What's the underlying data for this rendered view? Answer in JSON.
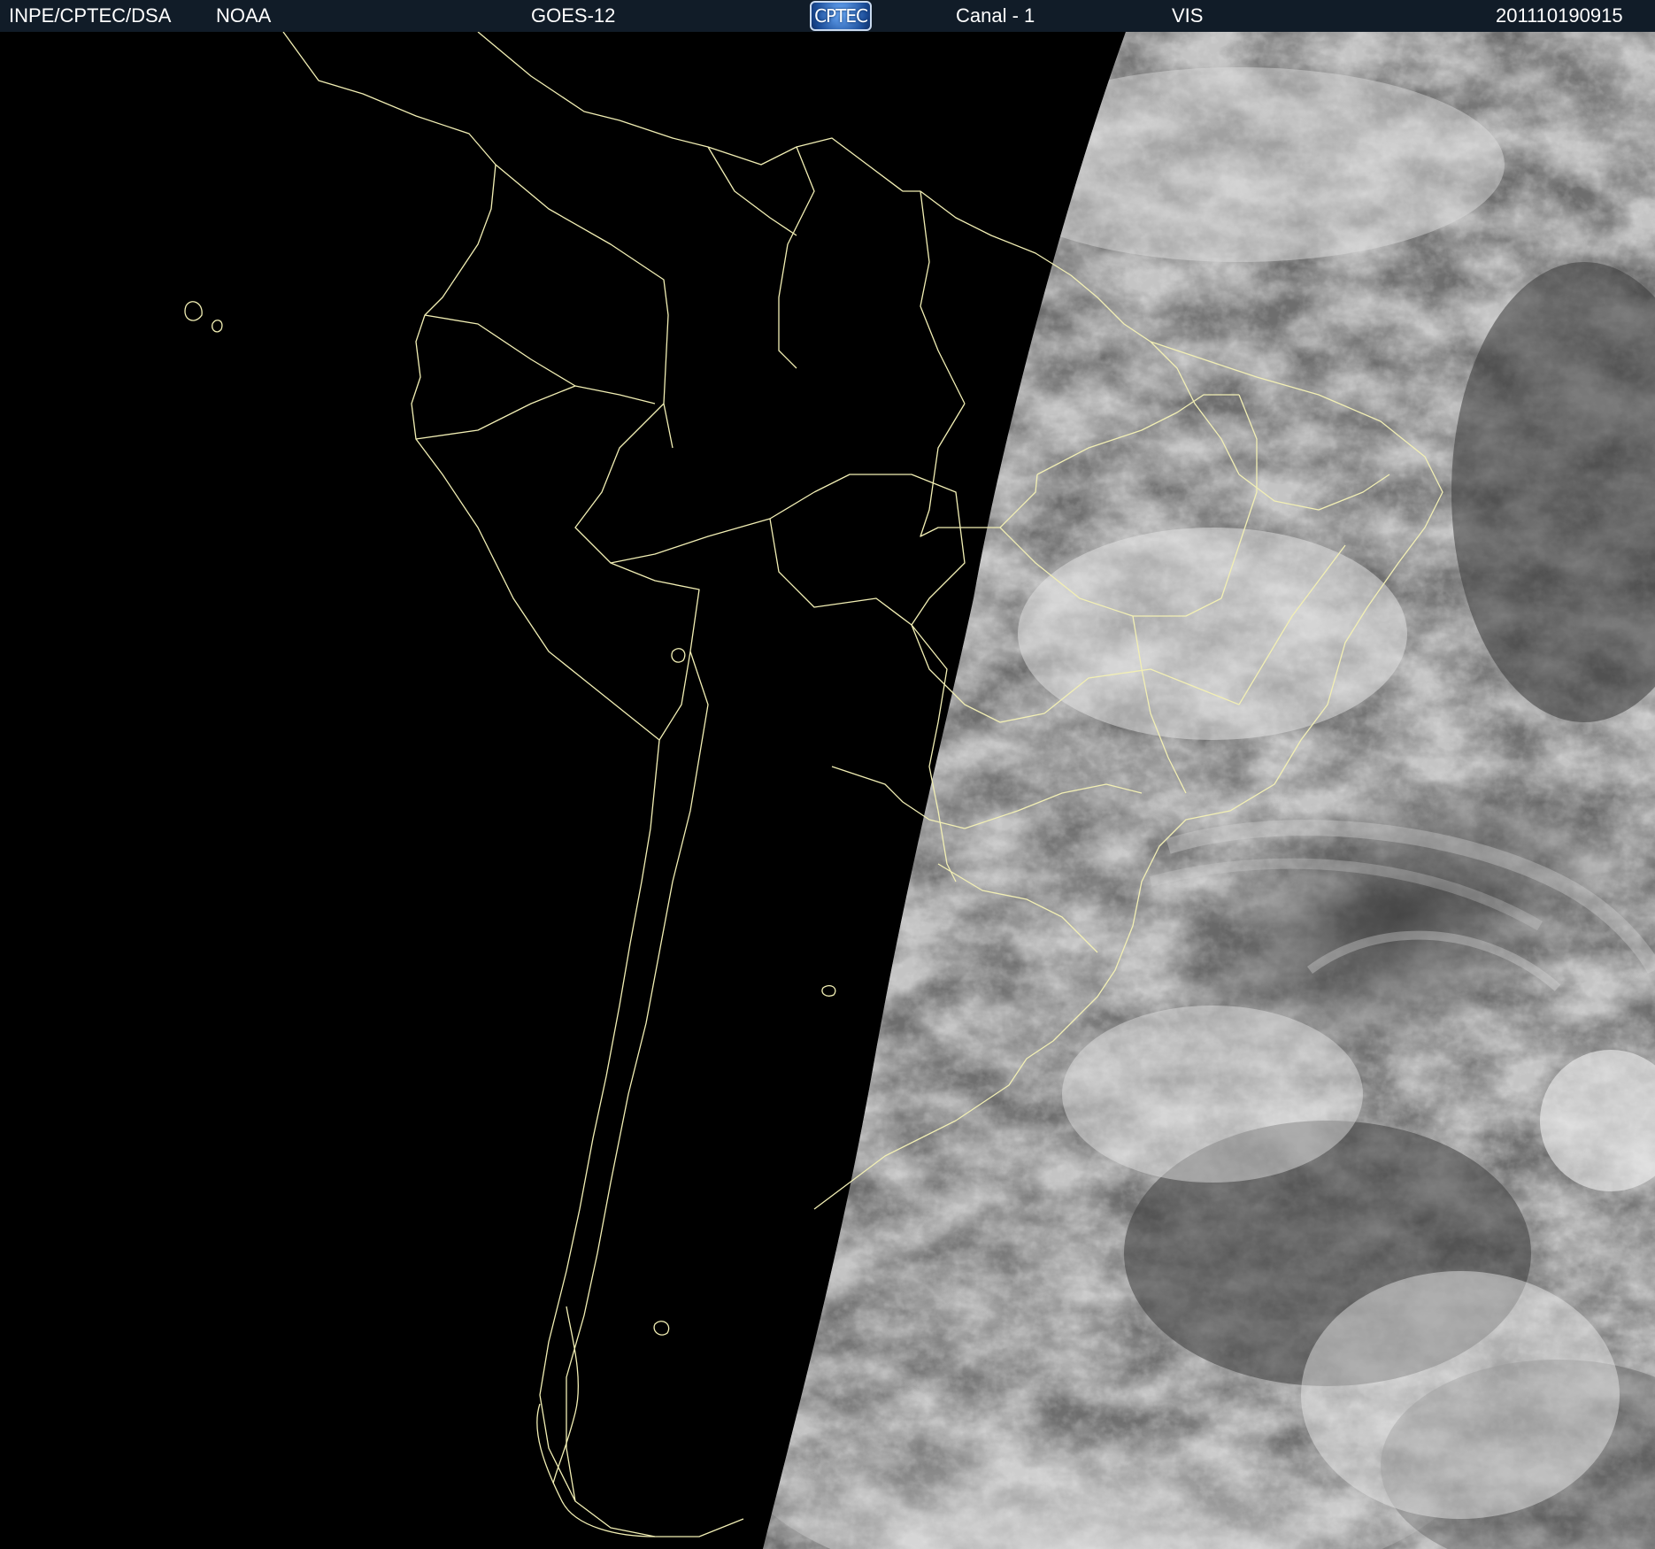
{
  "header": {
    "institution": "INPE/CPTEC/DSA",
    "agency": "NOAA",
    "satellite": "GOES-12",
    "logo_text": "CPTEC",
    "channel": "Canal - 1",
    "band": "VIS",
    "timestamp": "201110190915"
  },
  "colors": {
    "header_background": "#111c28",
    "header_text": "#ffffff",
    "night_side": "#000000",
    "coastline": "#f2efb4"
  },
  "image": {
    "description_type": "GOES-12 visible satellite image over South America with political boundaries",
    "icon_names": [
      "cptec-logo-icon"
    ]
  }
}
